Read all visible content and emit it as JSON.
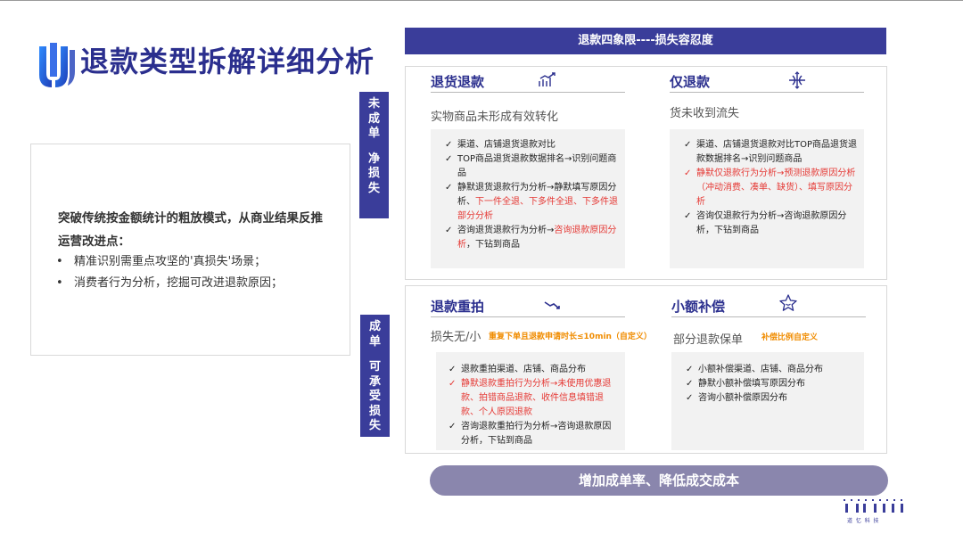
{
  "header": {
    "title": "退款类型拆解详细分析",
    "logo_icon": "u-shape-logo-icon"
  },
  "summary": {
    "heading": "突破传统按金额统计的粗放模式，从商业结果反推运营改进点：",
    "items": [
      "精准识别需重点攻坚的'真损失'场景；",
      "消费者行为分析，挖掘可改进退款原因；"
    ]
  },
  "labels": {
    "unfinished": [
      "未",
      "成",
      "单",
      "",
      "净",
      "损",
      "失"
    ],
    "finished": [
      "成",
      "单",
      "",
      "可",
      "承",
      "受",
      "损",
      "失"
    ]
  },
  "banner_top": "退款四象限----损失容忍度",
  "banner_bottom": "增加成单率、降低成交成本",
  "quadrants": {
    "return_refund": {
      "title": "退货退款",
      "icon": "rising-chart-icon",
      "subtitle": "实物商品未形成有效转化",
      "items": [
        {
          "text": "渠道、店铺退货退款对比"
        },
        {
          "text": "TOP商品退货退款数据排名→识别问题商品"
        },
        {
          "text": "静默退货退款行为分析→静默填写原因分析、",
          "red": "下一件全退、下多件全退、下多件退部分分析"
        },
        {
          "text": "咨询退货退款行为分析→",
          "red": "咨询退款原因分析",
          "tail": "，下钻到商品"
        }
      ]
    },
    "refund_only": {
      "title": "仅退款",
      "icon": "intersect-arrows-icon",
      "subtitle": "货未收到流失",
      "items": [
        {
          "text": "渠道、店铺退货退款对比TOP商品退货退款数据排名→识别问题商品"
        },
        {
          "warn": true,
          "text": "静默仅退款行为分析→预测退款原因分析（冲动消费、凑单、缺货）、填写原因分析"
        },
        {
          "text": "咨询仅退款行为分析→咨询退款原因分析，下钻到商品"
        }
      ]
    },
    "reorder": {
      "title": "退款重拍",
      "icon": "falling-trend-icon",
      "subtitle": "损失无/小",
      "note": "重复下单且退款申请时长≤10min（自定义）",
      "items": [
        {
          "text": "退款重拍渠道、店铺、商品分布"
        },
        {
          "warn": true,
          "text": "静默退款重拍行为分析→未使用优惠退款、拍错商品退款、收件信息填错退款、个人原因退款"
        },
        {
          "text": "咨询退款重拍行为分析→咨询退款原因分析，下钻到商品"
        }
      ]
    },
    "small_comp": {
      "title": "小额补偿",
      "icon": "star-icon",
      "subtitle": "部分退款保单",
      "note": "补偿比例自定义",
      "items": [
        {
          "text": "小额补偿渠道、店铺、商品分布"
        },
        {
          "text": "静默小额补偿填写原因分布"
        },
        {
          "text": "咨询小额补偿原因分布"
        }
      ]
    }
  },
  "brand": {
    "text": "道  忆  科  技",
    "icon": "brand-bars-logo-icon"
  },
  "colors": {
    "primary": "#3a3d9a",
    "title": "#2b2f8e",
    "highlight": "#e53935",
    "note": "#f08c00",
    "pill": "#8a86ad"
  }
}
